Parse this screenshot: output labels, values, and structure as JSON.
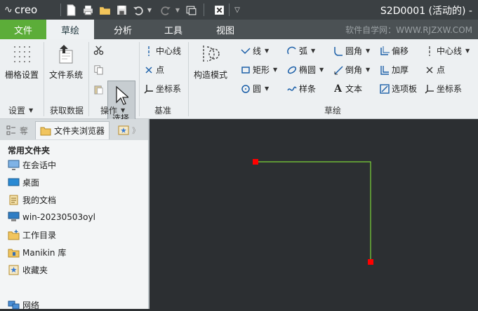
{
  "app": {
    "logo": "creo",
    "window_title": "S2D0001 (活动的) -",
    "watermark": "软件自学网：WWW.RJZXW.COM"
  },
  "tabs": [
    "文件",
    "草绘",
    "分析",
    "工具",
    "视图"
  ],
  "ribbon": {
    "grid_settings": "栅格设置",
    "file_system": "文件系统",
    "select": "选择",
    "centerline": "中心线",
    "point": "点",
    "coord_sys": "坐标系",
    "construction_mode": "构造模式",
    "line": "线",
    "rectangle": "矩形",
    "circle": "圆",
    "arc": "弧",
    "ellipse": "椭圆",
    "spline": "样条",
    "fillet": "圆角",
    "chamfer": "倒角",
    "text": "文本",
    "offset": "偏移",
    "thicken": "加厚",
    "palette": "选项板",
    "centerline2": "中心线",
    "point2": "点",
    "coord_sys2": "坐标系",
    "groups": {
      "settings": "设置",
      "get_data": "获取数据",
      "operations": "操作",
      "datum": "基准",
      "sketch": "草绘"
    }
  },
  "panel": {
    "tab_model": "奪",
    "tab_browser": "文件夹浏览器",
    "section": "常用文件夹",
    "items": [
      "在会话中",
      "桌面",
      "我的文档",
      "win-20230503oyl",
      "工作目录",
      "Manikin 库",
      "收藏夹",
      "网络"
    ]
  },
  "colors": {
    "file_tab": "#5cad39",
    "sketch_line": "#7cd43a",
    "endpoint": "#ff0000",
    "canvas_bg": "#2c2f32"
  }
}
